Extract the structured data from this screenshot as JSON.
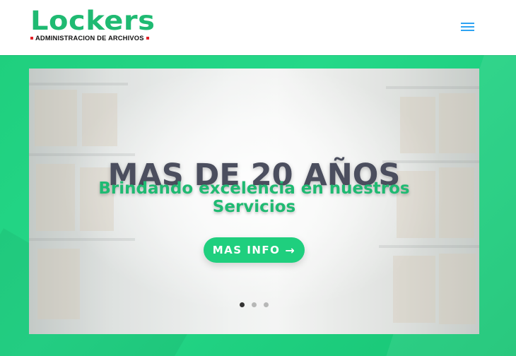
{
  "header": {
    "logo_word": "Lockers",
    "logo_tagline": "ADMINISTRACION DE ARCHIVOS",
    "menu_icon": "hamburger-menu-icon"
  },
  "slider": {
    "headline": "MAS DE 20 AÑOS",
    "subheadline": "Brindando excelencia en nuestros Servicios",
    "cta_label": "MAS INFO",
    "cta_icon": "arrow-right-icon",
    "cta_arrow": "→",
    "pagination": [
      "1",
      "2",
      "3"
    ],
    "active_slide": 1
  },
  "colors": {
    "brand_green": "#1fba72",
    "background_green": "#1ed07f",
    "headline_gray": "#4b4e5e",
    "menu_blue": "#2ea3f2",
    "logo_red": "#e2232a"
  }
}
